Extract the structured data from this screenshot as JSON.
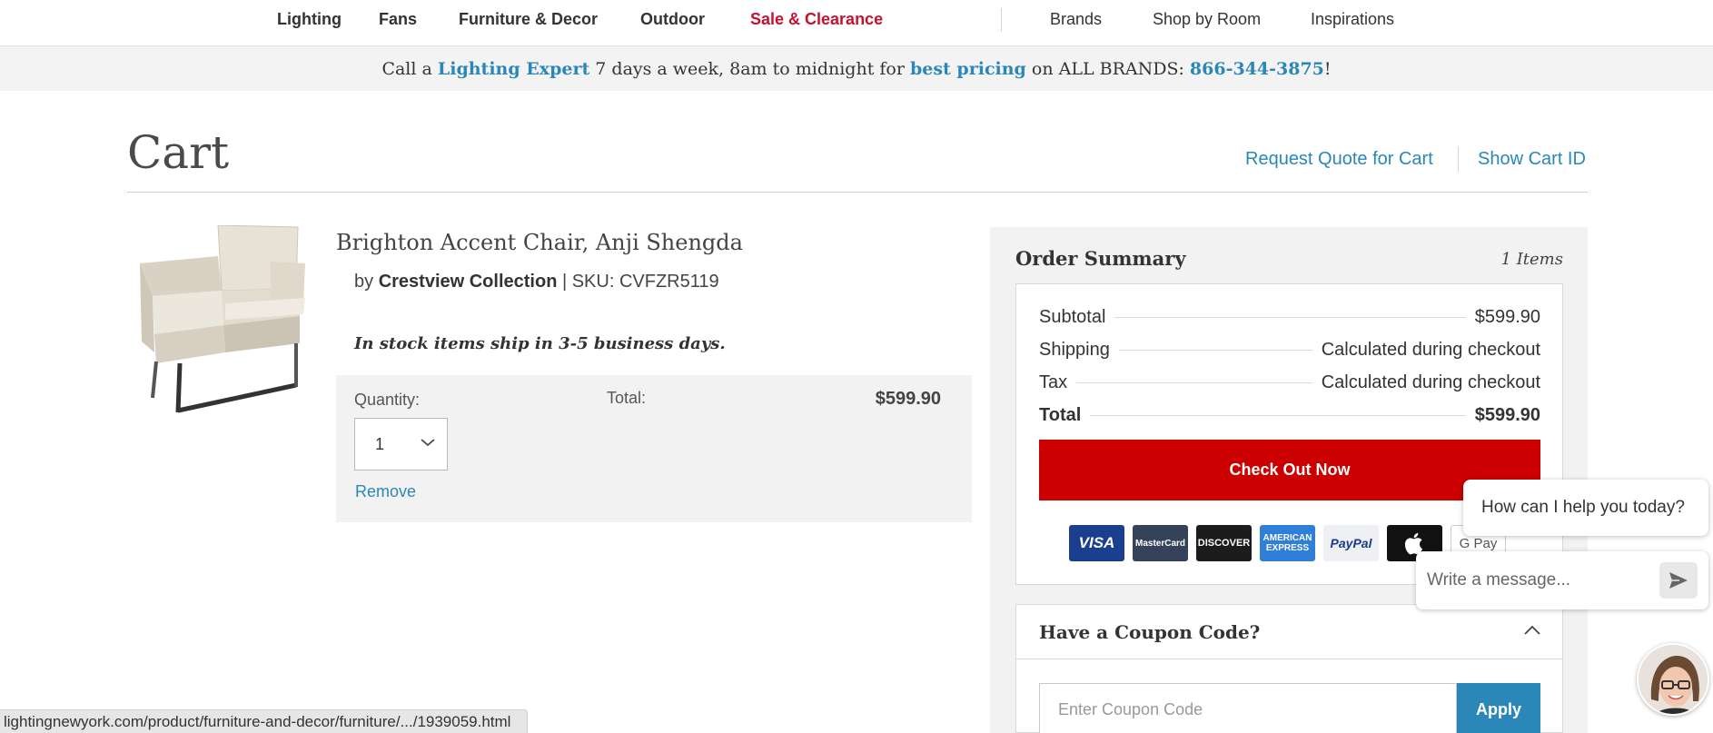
{
  "nav": {
    "items": [
      {
        "label": "Lighting",
        "style": "bold"
      },
      {
        "label": "Fans",
        "style": "bold"
      },
      {
        "label": "Furniture & Decor",
        "style": "bold"
      },
      {
        "label": "Outdoor",
        "style": "bold"
      },
      {
        "label": "Sale & Clearance",
        "style": "sale"
      },
      {
        "label": "Brands",
        "style": "normal"
      },
      {
        "label": "Shop by Room",
        "style": "normal"
      },
      {
        "label": "Inspirations",
        "style": "normal"
      }
    ]
  },
  "promo": {
    "prefix": "Call a ",
    "expert_link": "Lighting Expert",
    "middle": " 7 days a week, 8am to midnight for ",
    "pricing_link": "best pricing",
    "brands_text": " on ALL BRANDS: ",
    "phone": "866-344-3875",
    "suffix": "!"
  },
  "header": {
    "title": "Cart",
    "request_quote": "Request Quote for Cart",
    "show_cart_id": "Show Cart ID"
  },
  "product": {
    "name": "Brighton Accent Chair, Anji Shengda",
    "by_prefix": "by ",
    "brand": "Crestview Collection",
    "sku_text": " | SKU: CVFZR5119",
    "stock_message": "In stock items ship in 3-5 business days.",
    "quantity_label": "Quantity:",
    "quantity_value": "1",
    "remove_label": "Remove",
    "total_label": "Total:",
    "total_value": "$599.90",
    "image_icon": "accent-chair-image"
  },
  "summary": {
    "title": "Order Summary",
    "count": "1 Items",
    "lines": [
      {
        "label": "Subtotal",
        "value": "$599.90"
      },
      {
        "label": "Shipping",
        "value": "Calculated during checkout"
      },
      {
        "label": "Tax",
        "value": "Calculated during checkout"
      },
      {
        "label": "Total",
        "value": "$599.90"
      }
    ],
    "checkout_label": "Check Out Now",
    "payment_methods": [
      "VISA",
      "MasterCard",
      "DISCOVER",
      "AMERICAN EXPRESS",
      "PayPal",
      "",
      "G Pay"
    ]
  },
  "coupon": {
    "title": "Have a Coupon Code?",
    "placeholder": "Enter Coupon Code",
    "apply_label": "Apply"
  },
  "chat": {
    "greeting": "How can I help you today?",
    "placeholder": "Write a message..."
  },
  "status_url": "lightingnewyork.com/product/furniture-and-decor/furniture/.../1939059.html",
  "colors": {
    "accent_link": "#2a87b8",
    "sale_red": "#c8102e",
    "checkout_red": "#cc0000",
    "panel_gray": "#f2f2f2"
  }
}
